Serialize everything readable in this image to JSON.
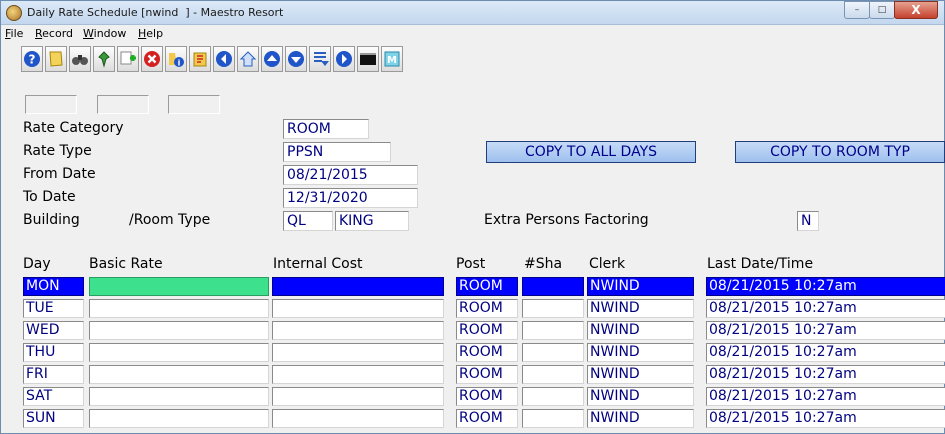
{
  "window": {
    "title": "Daily Rate Schedule [nwind  ] - Maestro Resort",
    "minimize": "–",
    "maximize": "□",
    "close": "X"
  },
  "menu": [
    {
      "underline": "F",
      "rest": "ile"
    },
    {
      "underline": "R",
      "rest": "ecord"
    },
    {
      "underline": "W",
      "rest": "indow"
    },
    {
      "underline": "H",
      "rest": "elp"
    }
  ],
  "toolbar": {
    "icons": [
      "help-icon",
      "note-icon",
      "binoculars-icon",
      "pin-icon",
      "add-icon",
      "delete-icon",
      "info-icon",
      "flag-icon",
      "back-icon",
      "home-icon",
      "up-icon",
      "down-icon",
      "list-icon",
      "forward-icon",
      "console-icon",
      "memo-icon"
    ]
  },
  "form": {
    "rate_category_label": "Rate Category",
    "rate_category_value": "ROOM",
    "rate_type_label": "Rate Type",
    "rate_type_value": "PPSN",
    "from_date_label": "From Date",
    "from_date_value": "08/21/2015",
    "to_date_label": "To Date",
    "to_date_value": "12/31/2020",
    "building_label": "Building",
    "room_type_label": "/Room Type",
    "building_value": "QL",
    "room_type_value": "KING",
    "extra_persons_label": "Extra Persons Factoring",
    "extra_persons_value": "N",
    "copy_all_days": "COPY TO ALL DAYS",
    "copy_room_type": "COPY TO ROOM TYP"
  },
  "grid": {
    "headers": {
      "day": "Day",
      "basic_rate": "Basic Rate",
      "internal_cost": "Internal Cost",
      "post": "Post",
      "sha": "#Sha",
      "clerk": "Clerk",
      "last": "Last Date/Time"
    },
    "rows": [
      {
        "day": "MON",
        "basic_rate": "",
        "internal_cost": "",
        "post": "ROOM",
        "sha": "",
        "clerk": "NWIND",
        "last": "08/21/2015 10:27am"
      },
      {
        "day": "TUE",
        "basic_rate": "",
        "internal_cost": "",
        "post": "ROOM",
        "sha": "",
        "clerk": "NWIND",
        "last": "08/21/2015 10:27am"
      },
      {
        "day": "WED",
        "basic_rate": "",
        "internal_cost": "",
        "post": "ROOM",
        "sha": "",
        "clerk": "NWIND",
        "last": "08/21/2015 10:27am"
      },
      {
        "day": "THU",
        "basic_rate": "",
        "internal_cost": "",
        "post": "ROOM",
        "sha": "",
        "clerk": "NWIND",
        "last": "08/21/2015 10:27am"
      },
      {
        "day": "FRI",
        "basic_rate": "",
        "internal_cost": "",
        "post": "ROOM",
        "sha": "",
        "clerk": "NWIND",
        "last": "08/21/2015 10:27am"
      },
      {
        "day": "SAT",
        "basic_rate": "",
        "internal_cost": "",
        "post": "ROOM",
        "sha": "",
        "clerk": "NWIND",
        "last": "08/21/2015 10:27am"
      },
      {
        "day": "SUN",
        "basic_rate": "",
        "internal_cost": "",
        "post": "ROOM",
        "sha": "",
        "clerk": "NWIND",
        "last": "08/21/2015 10:27am"
      }
    ]
  },
  "colors": {
    "selected_row": "#0000ff",
    "selected_basic_rate": "#3ce08d",
    "field_text": "#000080",
    "button_face": "#9ec0ee"
  }
}
